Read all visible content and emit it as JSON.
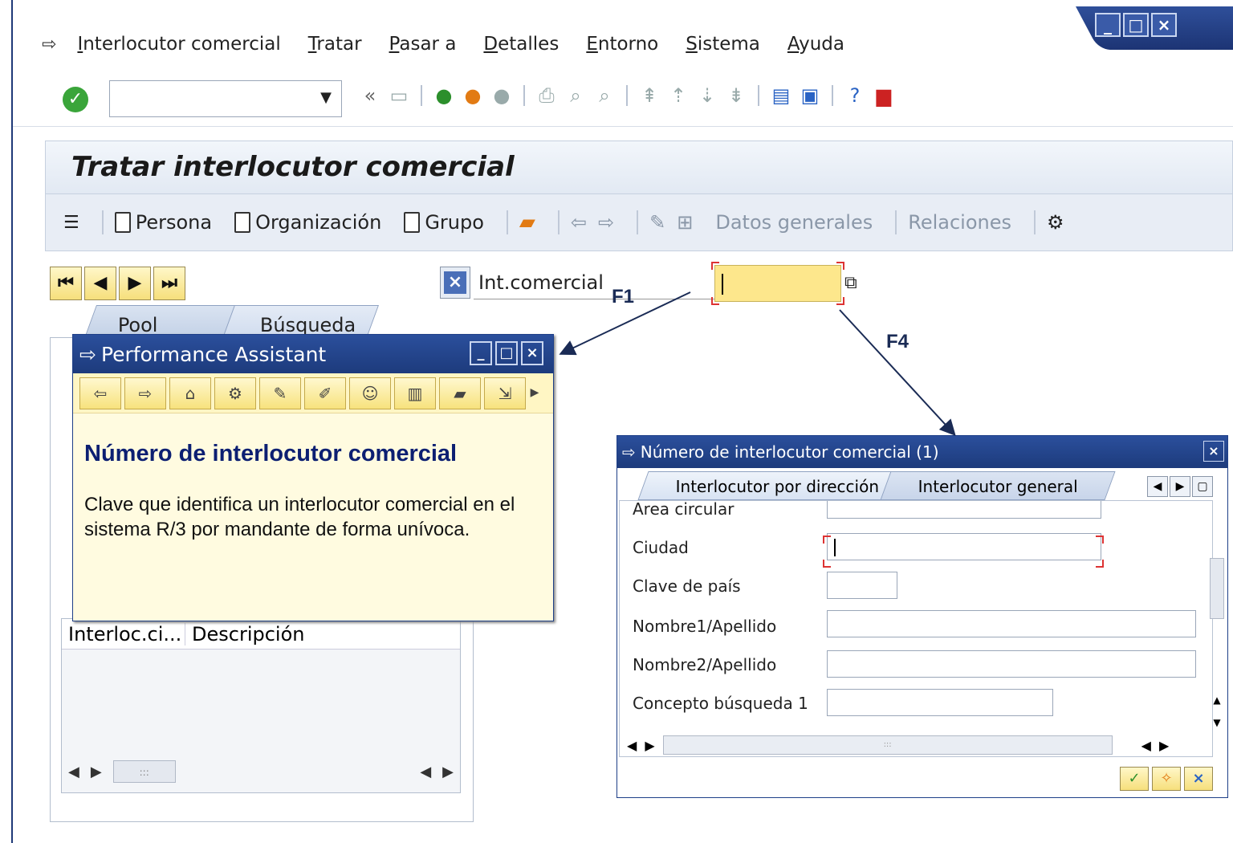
{
  "menu": {
    "items": [
      {
        "label": "Interlocutor comercial"
      },
      {
        "label": "Tratar"
      },
      {
        "label": "Pasar a"
      },
      {
        "label": "Detalles"
      },
      {
        "label": "Entorno"
      },
      {
        "label": "Sistema"
      },
      {
        "label": "Ayuda"
      }
    ]
  },
  "window_controls": [
    "minimize-icon",
    "maximize-icon",
    "close-icon"
  ],
  "toolbar": {
    "command_field_value": ""
  },
  "screen": {
    "title": "Tratar interlocutor comercial"
  },
  "app_toolbar": {
    "persona": "Persona",
    "organizacion": "Organización",
    "grupo": "Grupo",
    "datos_generales": "Datos generales",
    "relaciones": "Relaciones"
  },
  "bp_field": {
    "label": "Int.comercial",
    "value": ""
  },
  "annotations": {
    "f1": "F1",
    "f4": "F4"
  },
  "left_tabs": {
    "pool": "Pool trabajo",
    "busqueda": "Búsqueda"
  },
  "result_table": {
    "col1": "Interloc.ci...",
    "col2": "Descripción"
  },
  "performance_assistant": {
    "title": "Performance Assistant",
    "heading": "Número de interlocutor comercial",
    "text": "Clave que identifica un interlocutor comercial en el sistema R/3 por mandante de forma unívoca."
  },
  "search_dialog": {
    "title": "Número de interlocutor comercial (1)",
    "tabs": [
      "Interlocutor por dirección",
      "Interlocutor general"
    ],
    "fields": [
      {
        "label": "Area circular",
        "value": ""
      },
      {
        "label": "Ciudad",
        "value": ""
      },
      {
        "label": "Clave de país",
        "value": ""
      },
      {
        "label": "Nombre1/Apellido",
        "value": ""
      },
      {
        "label": "Nombre2/Apellido",
        "value": ""
      },
      {
        "label": "Concepto búsqueda 1",
        "value": ""
      }
    ]
  },
  "colors": {
    "title_blue": "#1d3b7c",
    "input_yellow": "#fde78c",
    "assist_bg": "#fffbe0"
  }
}
